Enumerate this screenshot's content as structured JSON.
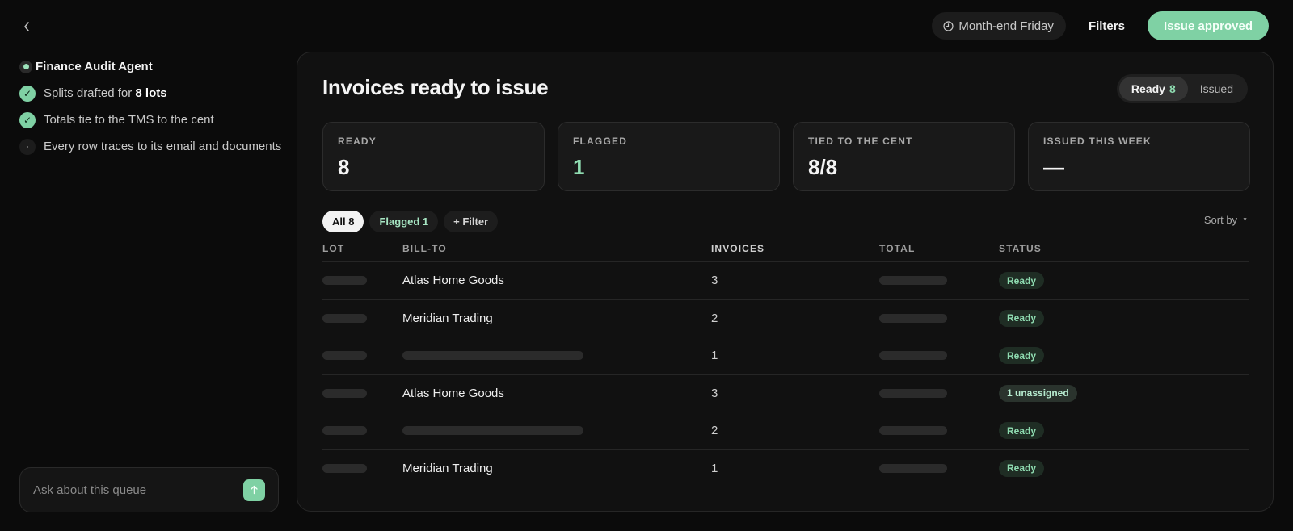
{
  "topbar": {
    "schedule_label": "Month-end Friday",
    "filters_label": "Filters",
    "issue_label": "Issue approved"
  },
  "agent": {
    "title": "Finance Audit Agent",
    "steps": [
      {
        "text_pre": "Splits drafted for ",
        "text_bold": "8 lots",
        "state": "done"
      },
      {
        "text_pre": "Totals tie to the TMS to the cent",
        "text_bold": "",
        "state": "done"
      },
      {
        "text_pre": "Every row traces to its email and documents",
        "text_bold": "",
        "state": "pending"
      }
    ]
  },
  "ask": {
    "placeholder": "Ask about this queue"
  },
  "main": {
    "title": "Invoices ready to issue",
    "segments": [
      {
        "label": "Ready",
        "count": "8",
        "active": true
      },
      {
        "label": "Issued",
        "count": "",
        "active": false
      }
    ],
    "kpis": [
      {
        "label": "READY",
        "value": "8",
        "accent": false
      },
      {
        "label": "FLAGGED",
        "value": "1",
        "accent": true
      },
      {
        "label": "TIED TO THE CENT",
        "value": "8/8",
        "accent": false
      },
      {
        "label": "ISSUED THIS WEEK",
        "value": "—",
        "accent": false
      }
    ],
    "chips": [
      {
        "label": "All 8",
        "active": true
      },
      {
        "label": "Flagged 1",
        "active": false
      },
      {
        "label": "+ Filter",
        "active": false
      }
    ],
    "sort_label": "Sort by",
    "table": {
      "columns": [
        "LOT",
        "BILL-TO",
        "INVOICES",
        "TOTAL",
        "STATUS"
      ],
      "rows": [
        {
          "bill_to": "Atlas Home Goods",
          "invoices": "3",
          "status": "Ready"
        },
        {
          "bill_to": "Meridian Trading",
          "invoices": "2",
          "status": "Ready"
        },
        {
          "bill_to": "",
          "invoices": "1",
          "status": "Ready"
        },
        {
          "bill_to": "Atlas Home Goods",
          "invoices": "3",
          "status": "1 unassigned"
        },
        {
          "bill_to": "",
          "invoices": "2",
          "status": "Ready"
        },
        {
          "bill_to": "Meridian Trading",
          "invoices": "1",
          "status": "Ready"
        }
      ]
    }
  }
}
